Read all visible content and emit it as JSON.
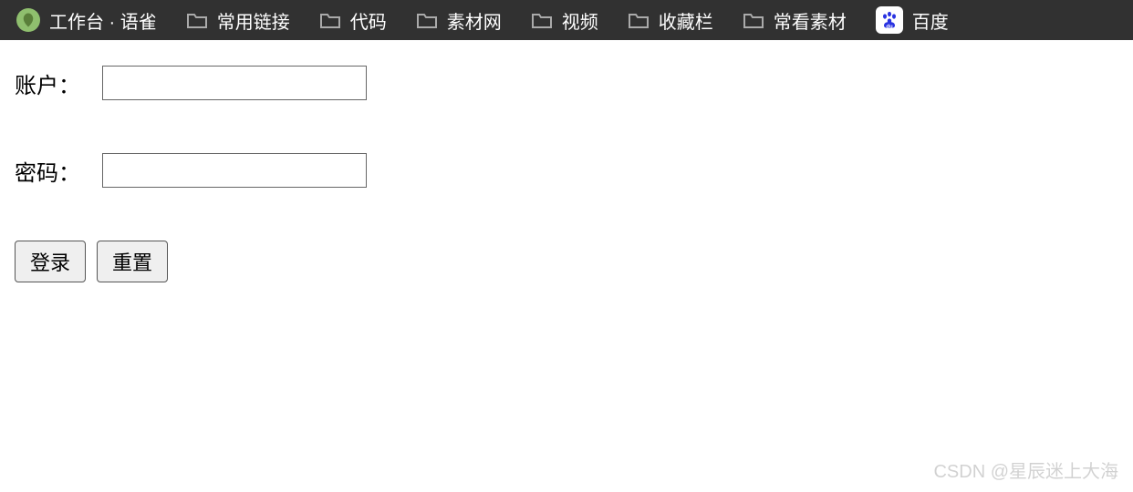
{
  "bookmarks": {
    "yuque": "工作台 · 语雀",
    "items": [
      "常用链接",
      "代码",
      "素材网",
      "视频",
      "收藏栏",
      "常看素材"
    ],
    "baidu": "百度"
  },
  "form": {
    "account_label": "账户：",
    "account_value": "",
    "password_label": "密码：",
    "password_value": "",
    "login_btn": "登录",
    "reset_btn": "重置"
  },
  "watermark": "CSDN @星辰迷上大海"
}
